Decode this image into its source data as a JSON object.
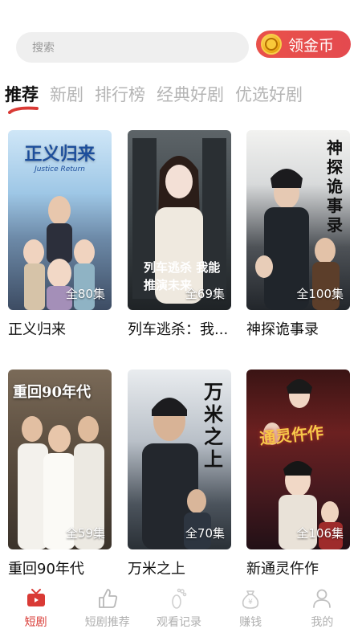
{
  "search": {
    "placeholder": "搜索"
  },
  "coin_button": {
    "label": "领金币",
    "icon": "gold-coin-icon"
  },
  "tabs": [
    {
      "label": "推荐",
      "active": true
    },
    {
      "label": "新剧",
      "active": false
    },
    {
      "label": "排行榜",
      "active": false
    },
    {
      "label": "经典好剧",
      "active": false
    },
    {
      "label": "优选好剧",
      "active": false
    }
  ],
  "dramas": [
    {
      "title": "正义归来",
      "episodes": "全80集",
      "poster_title": "正义归来",
      "poster_subtitle": "Justice Return"
    },
    {
      "title": "列车逃杀：我...",
      "episodes": "全69集",
      "poster_title": "列车逃杀 我能推演未来",
      "poster_subtitle": ""
    },
    {
      "title": "神探诡事录",
      "episodes": "全100集",
      "poster_title": "神探诡事录",
      "poster_subtitle": ""
    },
    {
      "title": "重回90年代",
      "episodes": "全59集",
      "poster_title": "重回90年代",
      "poster_subtitle": ""
    },
    {
      "title": "万米之上",
      "episodes": "全70集",
      "poster_title": "万米之上",
      "poster_subtitle": ""
    },
    {
      "title": "新通灵仵作",
      "episodes": "全106集",
      "poster_title": "通灵仵作",
      "poster_subtitle": ""
    }
  ],
  "bottom_nav": [
    {
      "label": "短剧",
      "icon": "tv-icon",
      "active": true
    },
    {
      "label": "短剧推荐",
      "icon": "thumbs-up-icon",
      "active": false
    },
    {
      "label": "观看记录",
      "icon": "footprint-icon",
      "active": false
    },
    {
      "label": "赚钱",
      "icon": "money-bag-icon",
      "active": false
    },
    {
      "label": "我的",
      "icon": "user-icon",
      "active": false
    }
  ],
  "colors": {
    "accent": "#d93a35",
    "coin_button": "#e64c4c",
    "inactive": "#b0b0b0"
  }
}
